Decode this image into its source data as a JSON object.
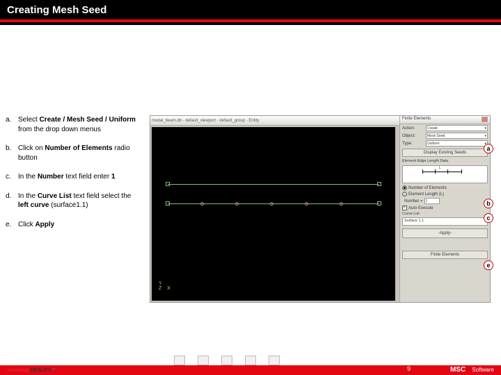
{
  "header": {
    "title": "Creating Mesh Seed"
  },
  "steps": [
    {
      "label": "a.",
      "prefix": "Select ",
      "bold": "Create / Mesh Seed / Uniform",
      "suffix": " from the drop down menus"
    },
    {
      "label": "b.",
      "prefix": "Click on ",
      "bold": "Number of Elements",
      "suffix": " radio button"
    },
    {
      "label": "c.",
      "prefix": "In the ",
      "bold": "Number",
      "suffix": " text field enter ",
      "bold2": "1"
    },
    {
      "label": "d.",
      "prefix": "In the ",
      "bold": "Curve List",
      "mid": " text field select the ",
      "bold2": "left curve",
      "suffix": " (surface1.1)"
    },
    {
      "label": "e.",
      "prefix": "Click ",
      "bold": "Apply",
      "suffix": ""
    }
  ],
  "window": {
    "title": "modal_beam.db - default_viewport - default_group - Entity",
    "panel_title": "Finite Elements",
    "action_label": "Action:",
    "action_value": "Create",
    "object_label": "Object:",
    "object_value": "Mesh Seed",
    "type_label": "Type:",
    "type_value": "Uniform",
    "display_seeds": "Display Existing Seeds",
    "edge_data_title": "Element Edge Length Data",
    "L_label": "L",
    "num_elem_label": "Number of Elements",
    "elem_len_label": "Element Length (L)",
    "number_label": "Number =",
    "number_value": "1",
    "auto_execute": "Auto Execute",
    "curve_list_label": "Curve List",
    "curve_list_value": "Surface 1.1",
    "apply_label": "-Apply-",
    "bottom_label": "Finite Elements"
  },
  "callouts": {
    "a": "a",
    "b": "b",
    "c": "c",
    "e": "e"
  },
  "footer": {
    "page": "9",
    "sim": "simulating REALITY™",
    "logo_prefix": "MSC",
    "logo_suffix": "Software"
  }
}
